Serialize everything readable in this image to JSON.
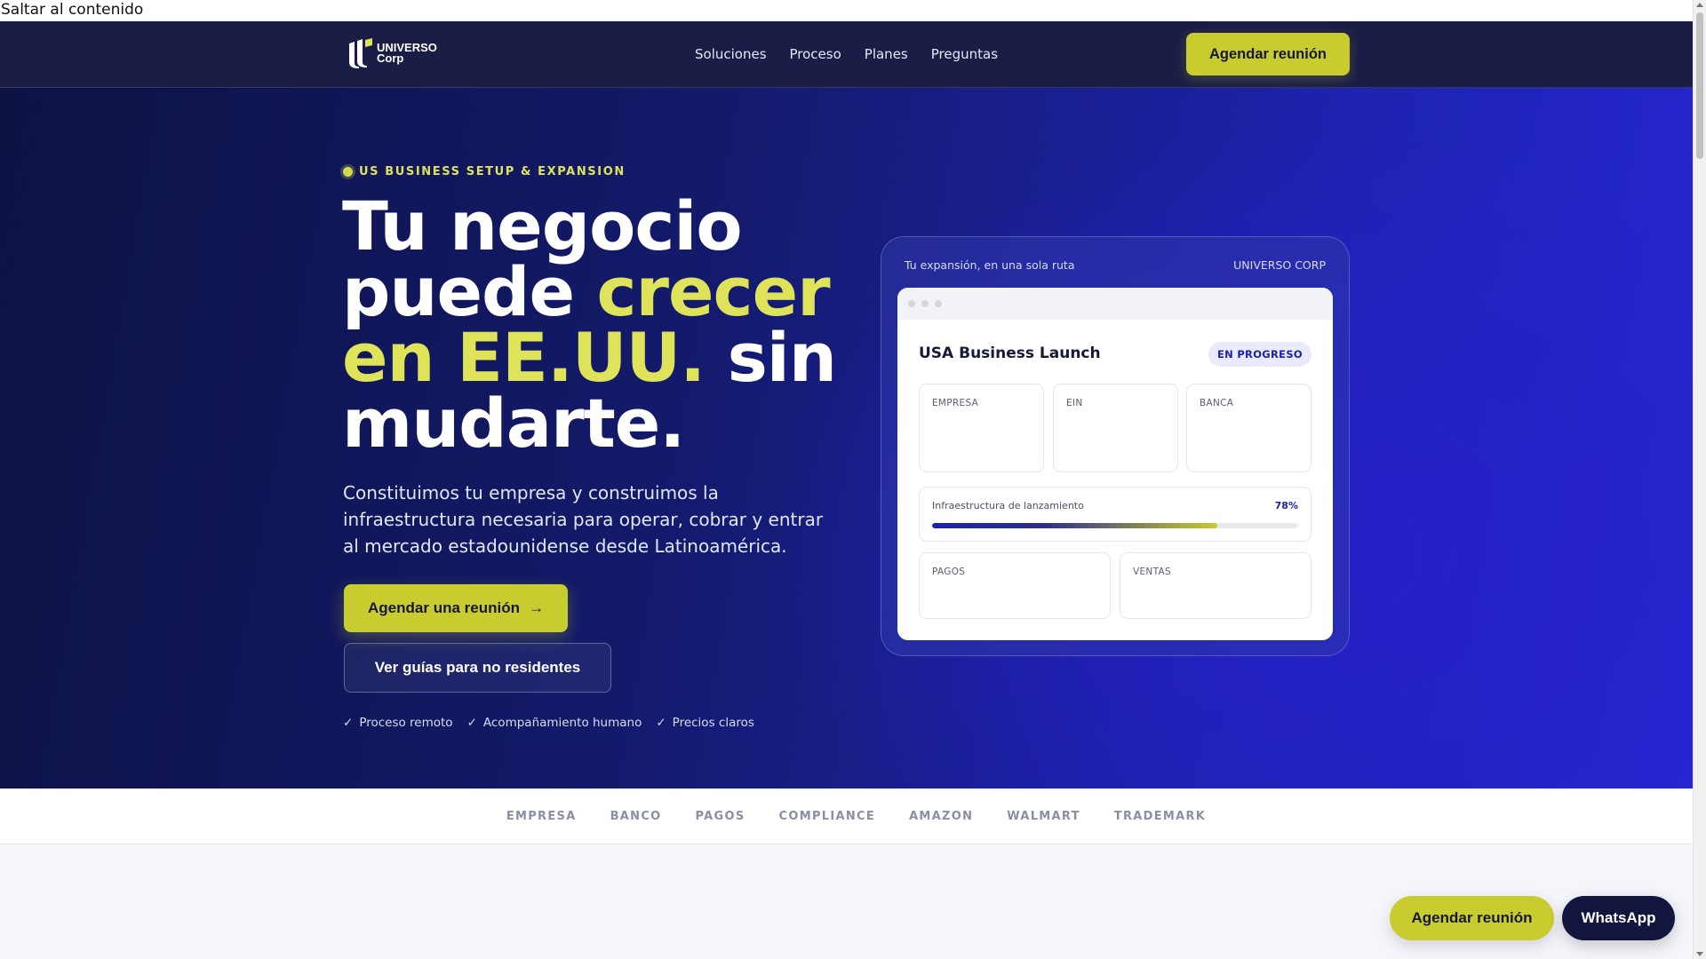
{
  "skip_link": "Saltar al contenido",
  "header": {
    "logo_line1": "UNIVERSO",
    "logo_line2": "Corp",
    "nav": [
      "Soluciones",
      "Proceso",
      "Planes",
      "Preguntas"
    ],
    "cta": "Agendar reunión"
  },
  "hero": {
    "eyebrow": "US BUSINESS SETUP & EXPANSION",
    "title_1": "Tu negocio",
    "title_2": "puede ",
    "title_accent_1": "crecer",
    "title_accent_2": "en EE.UU.",
    "title_3": " sin",
    "title_4": "mudarte.",
    "description": "Constituimos tu empresa y construimos la infraestructura necesaria para operar, cobrar y entrar al mercado estadounidense desde Latinoamérica.",
    "primary_cta": "Agendar una reunión",
    "primary_cta_arrow": "→",
    "secondary_cta": "Ver guías para no residentes",
    "checks": [
      "Proceso remoto",
      "Acompañamiento humano",
      "Precios claros"
    ],
    "check_glyph": "✓"
  },
  "card": {
    "caption": "Tu expansión, en una sola ruta",
    "brand": "UNIVERSO CORP",
    "launch_title": "USA Business Launch",
    "status": "EN PROGRESO",
    "tiles_top": [
      "EMPRESA",
      "EIN",
      "BANCA"
    ],
    "progress_label": "Infraestructura de lanzamiento",
    "progress_text": "78%",
    "progress_value": 0.78,
    "tiles_bottom": [
      "PAGOS",
      "VENTAS"
    ]
  },
  "logos": [
    "EMPRESA",
    "BANCO",
    "PAGOS",
    "COMPLIANCE",
    "AMAZON",
    "WALMART",
    "TRADEMARK"
  ],
  "floating": {
    "cta": "Agendar reunión",
    "whatsapp": "WhatsApp"
  },
  "colors": {
    "accent": "#c9cc2e",
    "hero_bg": "#131a6a",
    "brand_blue": "#1b1fa8"
  }
}
